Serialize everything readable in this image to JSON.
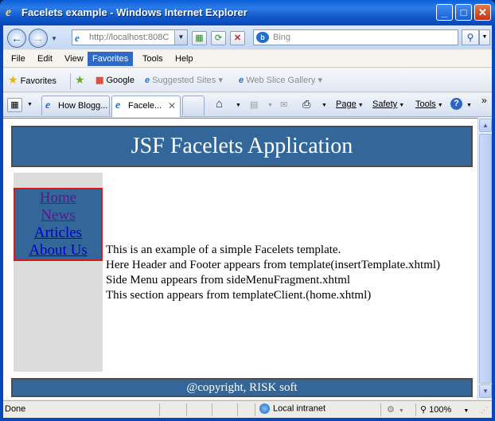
{
  "window": {
    "title": "Facelets example - Windows Internet Explorer"
  },
  "address": {
    "url": "http://localhost:808C",
    "search_placeholder": "Bing"
  },
  "menubar": {
    "items": [
      "File",
      "Edit",
      "View",
      "Favorites",
      "Tools",
      "Help"
    ],
    "active": "Favorites"
  },
  "favorites_bar": {
    "favorites_label": "Favorites",
    "links": [
      "Google",
      "Suggested Sites ▾",
      "Web Slice Gallery ▾"
    ]
  },
  "tabs": [
    {
      "label": "How Blogg..."
    },
    {
      "label": "Facele..."
    }
  ],
  "commands": {
    "page": "Page",
    "safety": "Safety",
    "tools": "Tools"
  },
  "page": {
    "header": "JSF Facelets Application",
    "menu": [
      "Home",
      "News",
      "Articles",
      "About Us"
    ],
    "body_lines": [
      "This is an example of a simple Facelets template.",
      "Here Header and Footer appears from template(insertTemplate.xhtml)",
      "Side Menu appears from sideMenuFragment.xhtml",
      "This section appears from templateClient.(home.xhtml)"
    ],
    "footer": "@copyright, RISK soft"
  },
  "status": {
    "text": "Done",
    "zone": "Local intranet",
    "zoom": "100%"
  },
  "colors": {
    "page_header_bg": "#336699",
    "sidebar_bg": "#dcdcdc",
    "menu_border": "#d61b1b"
  }
}
